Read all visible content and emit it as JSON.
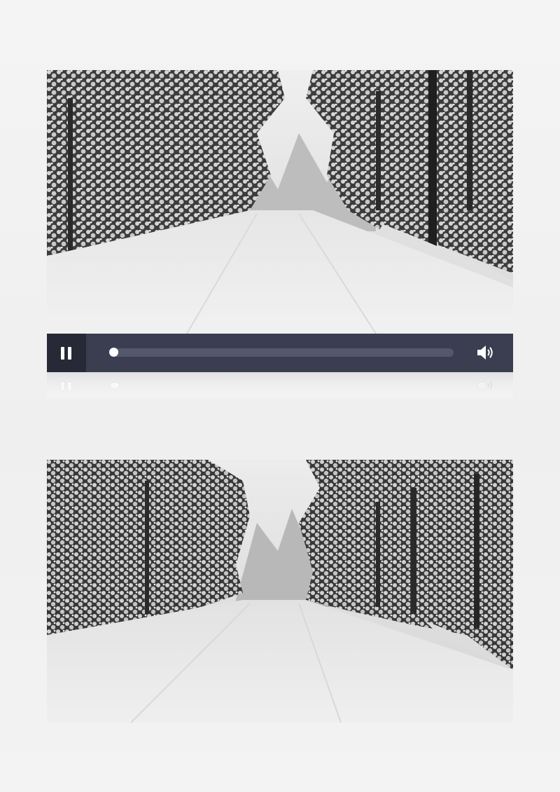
{
  "player": {
    "state": "playing",
    "controls": {
      "pause_icon": "pause-icon",
      "volume_icon": "volume-icon",
      "progress_fraction": 0.0
    }
  },
  "frames": [
    {
      "scene": "snowy-forest-road"
    },
    {
      "scene": "snowy-forest-road"
    }
  ],
  "colors": {
    "control_bar": "#3a3e50",
    "pause_button_bg": "#272a36",
    "progress_track": "#54586c",
    "progress_thumb": "#ffffff",
    "page_bg": "#f2f2f2"
  }
}
